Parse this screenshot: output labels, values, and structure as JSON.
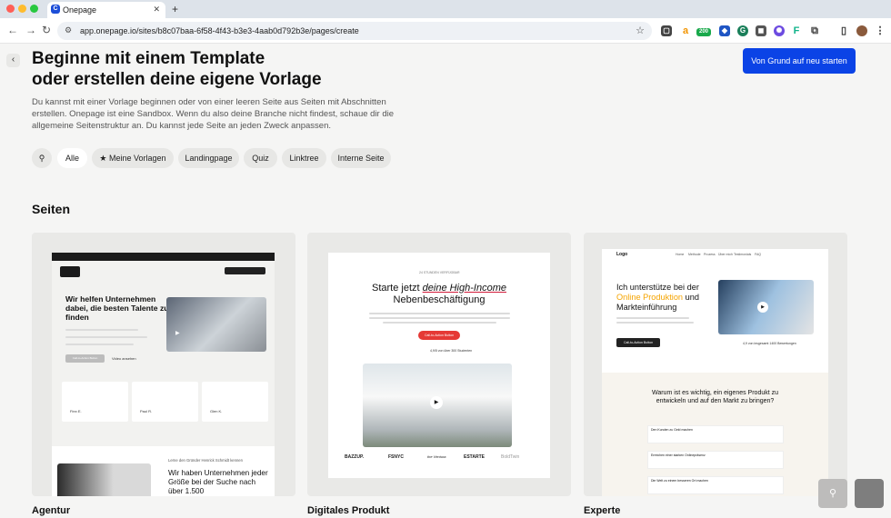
{
  "browser": {
    "tab_title": "Onepage",
    "url": "app.onepage.io/sites/b8c07baa-6f58-4f43-b3e3-4aab0d792b3e/pages/create",
    "ext_badge": "200"
  },
  "header": {
    "title": "Beginne mit einem Template\noder erstellen deine eigene Vorlage",
    "description": "Du kannst mit einer Vorlage beginnen oder von einer leeren Seite aus Seiten mit Abschnitten erstellen. Onepage ist eine Sandbox. Wenn du also deine Branche nicht findest, schaue dir die allgemeine Seitenstruktur an. Du kannst jede Seite an jeden Zweck anpassen.",
    "restart_button": "Von Grund auf neu starten"
  },
  "filters": [
    {
      "label": "Alle",
      "active": true
    },
    {
      "label": "Meine Vorlagen"
    },
    {
      "label": "Landingpage"
    },
    {
      "label": "Quiz"
    },
    {
      "label": "Linktree"
    },
    {
      "label": "Interne Seite"
    }
  ],
  "section_title": "Seiten",
  "cards": [
    {
      "caption": "Agentur",
      "headline": "Wir helfen Unternehmen dabei, die besten Talente zu finden",
      "cta": "Call-to-Action Button",
      "video_label": "Video ansehen",
      "founder_line": "Lerne den Gründer Henrick Schmidt kennen",
      "headline2": "Wir haben Unternehmen jeder Größe bei der Suche nach über 1.500",
      "reviewers": [
        "Finn E.",
        "Paul R.",
        "Glen K."
      ]
    },
    {
      "caption": "Digitales Produkt",
      "badge": "24 STUNDEN VERFÜGBAR",
      "headline_pre": "Starte jetzt ",
      "headline_hl": "deine High-Income",
      "headline_post": "Nebenbeschäftigung",
      "cta": "Call-to-Action Button",
      "rating": "4,9/5 von über 300 Studenten",
      "logos": [
        "BAZZUP.",
        "FSNYC",
        "the Ventura",
        "ESTARTE",
        "BoldTwin"
      ]
    },
    {
      "caption": "Experte",
      "logo": "Logo",
      "nav": [
        "Home",
        "Methode",
        "Prozess",
        "Über mich",
        "Testimonials",
        "FAQ"
      ],
      "headline_pre": "Ich unterstütze bei der",
      "headline_hl": "Online Produktion",
      "headline_mid": " und",
      "headline_post": "Markteinführung",
      "cta": "Call-to-Action Button",
      "rating": "4,9 von insgesamt 1400 Bewertungen",
      "question": "Warum ist es wichtig, ein eigenes Produkt zu entwickeln und auf den Markt zu bringen?",
      "faq": [
        "Den Kunden zu Geld machen",
        "Erreichen einer starken Onlinepräsenz",
        "Die Welt zu einem besseren Ort machen"
      ]
    }
  ],
  "colors": {
    "accent": "#0b43e6",
    "highlight_orange": "#f5a400",
    "highlight_red": "#d21b3a"
  },
  "icons": [
    "search-icon",
    "star-icon",
    "back-icon",
    "video-play-icon"
  ]
}
